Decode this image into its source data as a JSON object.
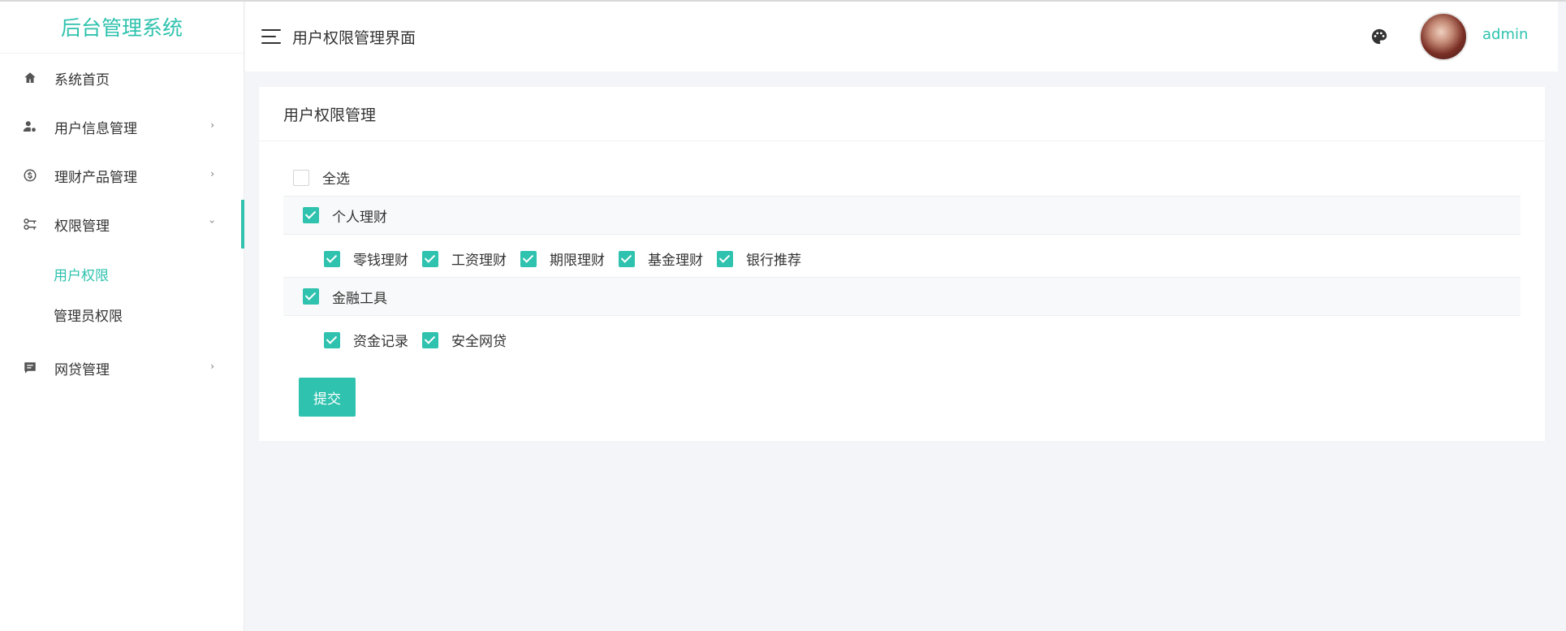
{
  "brand": "后台管理系统",
  "sidebar": {
    "items": [
      {
        "label": "系统首页",
        "icon": "home-icon"
      },
      {
        "label": "用户信息管理",
        "icon": "user-gear-icon",
        "arrow": "›"
      },
      {
        "label": "理财产品管理",
        "icon": "dollar-circle-icon",
        "arrow": "›"
      },
      {
        "label": "权限管理",
        "icon": "key-icon",
        "arrow": "›"
      },
      {
        "label": "网贷管理",
        "icon": "message-icon",
        "arrow": "›"
      }
    ],
    "submenu": [
      "用户权限",
      "管理员权限"
    ],
    "active_submenu": "用户权限",
    "accent_color": "#2fc2ae"
  },
  "header": {
    "title": "用户权限管理界面",
    "user": "admin",
    "icons": [
      "menu-icon",
      "palette-icon",
      "avatar"
    ]
  },
  "card": {
    "title": "用户权限管理",
    "select_all": {
      "label": "全选",
      "checked": false
    },
    "groups": [
      {
        "label": "个人理财",
        "checked": true,
        "children": [
          "零钱理财",
          "工资理财",
          "期限理财",
          "基金理财",
          "银行推荐"
        ]
      },
      {
        "label": "金融工具",
        "checked": true,
        "children": [
          "资金记录",
          "安全网贷"
        ]
      }
    ],
    "submit_label": "提交"
  }
}
